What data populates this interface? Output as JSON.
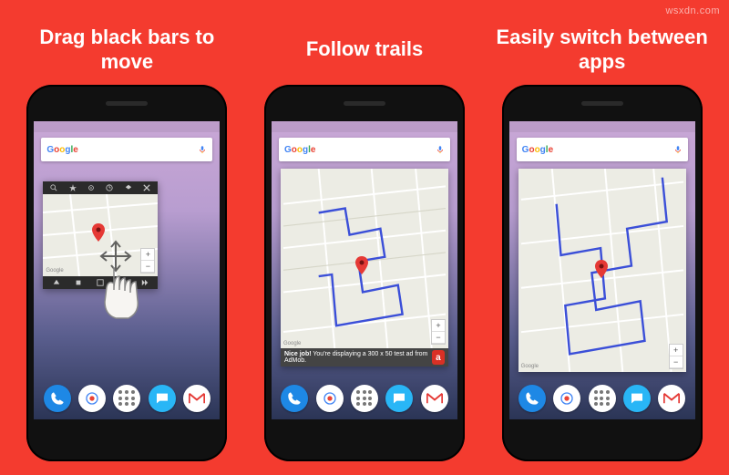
{
  "watermark": "wsxdn.com",
  "panels": [
    {
      "title": "Drag black bars to move"
    },
    {
      "title": "Follow trails"
    },
    {
      "title": "Easily switch between apps"
    }
  ],
  "search": {
    "logo": "Google"
  },
  "zoom": {
    "plus": "+",
    "minus": "−"
  },
  "ad": {
    "text_a": "Nice job!",
    "text_b": "You're displaying a 300 x 50 test ad from AdMob.",
    "badge": "a"
  },
  "map_attrib": "Google",
  "toolbar_icons": [
    "search",
    "star",
    "target",
    "clock",
    "layers",
    "close"
  ],
  "bottom_icons": [
    "up",
    "stop",
    "square",
    "rewind",
    "forward"
  ]
}
